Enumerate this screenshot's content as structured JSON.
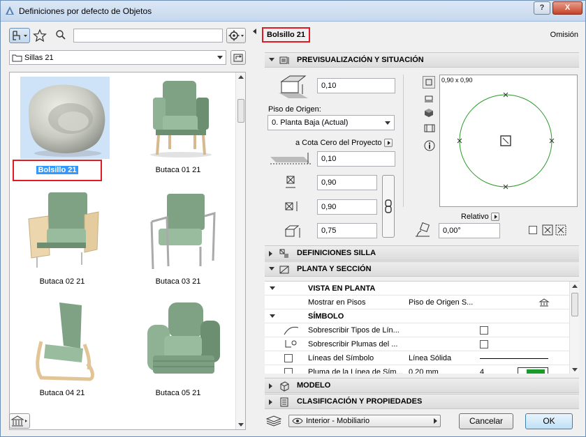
{
  "window": {
    "title": "Definiciones por defecto de Objetos",
    "help": "?",
    "close": "X"
  },
  "left": {
    "search_placeholder": "",
    "folder": "Sillas 21",
    "items": [
      {
        "label": "Bolsillo 21"
      },
      {
        "label": "Butaca 01 21"
      },
      {
        "label": "Butaca 02 21"
      },
      {
        "label": "Butaca 03 21"
      },
      {
        "label": "Butaca 04 21"
      },
      {
        "label": "Butaca 05 21"
      }
    ]
  },
  "right": {
    "object_name": "Bolsillo 21",
    "omision": "Omisión",
    "sections": {
      "preview": "PREVISUALIZACIÓN Y SITUACIÓN",
      "silla": "DEFINICIONES SILLA",
      "planta": "PLANTA Y SECCIÓN",
      "modelo": "MODELO",
      "clasif": "CLASIFICACIÓN Y PROPIEDADES"
    },
    "elev_value": "0,10",
    "piso_label": "Piso de Origen:",
    "piso_value": "0. Planta Baja (Actual)",
    "cota_label": "a Cota Cero del Proyecto",
    "cota_value": "0,10",
    "x_value": "0,90",
    "y_value": "0,90",
    "z_value": "0,75",
    "preview_size": "0,90 x 0,90",
    "relativo": "Relativo",
    "angle": "0,00°",
    "table": {
      "vista": "VISTA EN PLANTA",
      "mostrar_label": "Mostrar en Pisos",
      "mostrar_value": "Piso de Origen S...",
      "simbolo": "SÍMBOLO",
      "sobre_tipos": "Sobrescribir Tipos de Lín...",
      "sobre_plumas": "Sobrescribir Plumas del ...",
      "lineas_label": "Líneas del Símbolo",
      "lineas_value": "Línea Sólida",
      "pluma_label": "Pluma de la Línea de Sím...",
      "pluma_value": "0,20 mm",
      "pluma_num": "4"
    },
    "layer": "Interior - Mobiliario",
    "cancel": "Cancelar",
    "ok": "OK"
  }
}
